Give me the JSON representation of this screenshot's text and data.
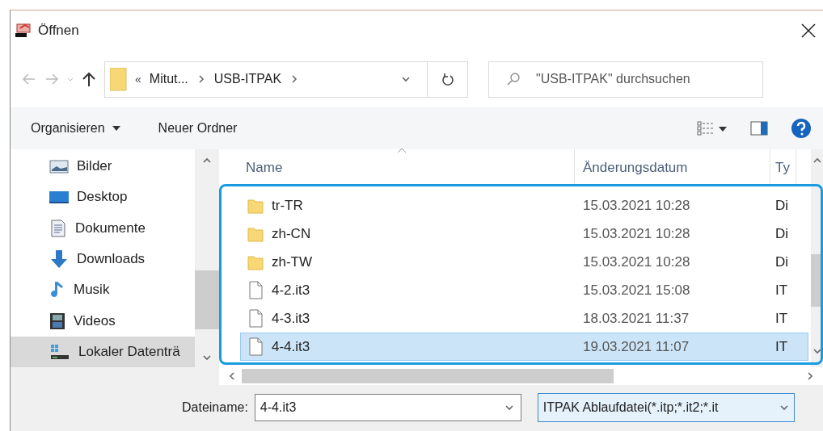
{
  "window": {
    "title": "Öffnen"
  },
  "navigation": {
    "overflow_marker": "«",
    "path": [
      "Mitut...",
      "USB-ITPAK"
    ],
    "search": {
      "placeholder": "\"USB-ITPAK\" durchsuchen"
    }
  },
  "toolbar": {
    "buttons": [
      {
        "label": "Organisieren",
        "kind": "menu"
      },
      {
        "label": "Neuer Ordner",
        "kind": "plain"
      }
    ]
  },
  "sidebar": {
    "items": [
      {
        "label": "Bilder",
        "kind": "pictures",
        "selected": false
      },
      {
        "label": "Desktop",
        "kind": "desktop",
        "selected": false
      },
      {
        "label": "Dokumente",
        "kind": "documents",
        "selected": false
      },
      {
        "label": "Downloads",
        "kind": "downloads",
        "selected": false
      },
      {
        "label": "Musik",
        "kind": "music",
        "selected": false
      },
      {
        "label": "Videos",
        "kind": "videos",
        "selected": false
      },
      {
        "label": "Lokaler Datenträ",
        "kind": "drive",
        "selected": true
      }
    ]
  },
  "file_list": {
    "columns": [
      {
        "label": "Name",
        "sorted": true
      },
      {
        "label": "Änderungsdatum",
        "sorted": false
      },
      {
        "label": "Ty",
        "sorted": false
      }
    ],
    "rows": [
      {
        "name": "tr-TR",
        "kind": "folder",
        "modified": "15.03.2021 10:28",
        "type": "Di",
        "selected": false
      },
      {
        "name": "zh-CN",
        "kind": "folder",
        "modified": "15.03.2021 10:28",
        "type": "Di",
        "selected": false
      },
      {
        "name": "zh-TW",
        "kind": "folder",
        "modified": "15.03.2021 10:28",
        "type": "Di",
        "selected": false
      },
      {
        "name": "4-2.it3",
        "kind": "file",
        "modified": "15.03.2021 15:08",
        "type": "IT",
        "selected": false
      },
      {
        "name": "4-3.it3",
        "kind": "file",
        "modified": "18.03.2021 11:37",
        "type": "IT",
        "selected": false
      },
      {
        "name": "4-4.it3",
        "kind": "file",
        "modified": "19.03.2021 11:07",
        "type": "IT",
        "selected": true
      }
    ]
  },
  "footer": {
    "filename_label": "Dateiname:",
    "filename": "4-4.it3",
    "filter": "ITPAK Ablaufdatei(*.itp;*.it2;*.it"
  }
}
